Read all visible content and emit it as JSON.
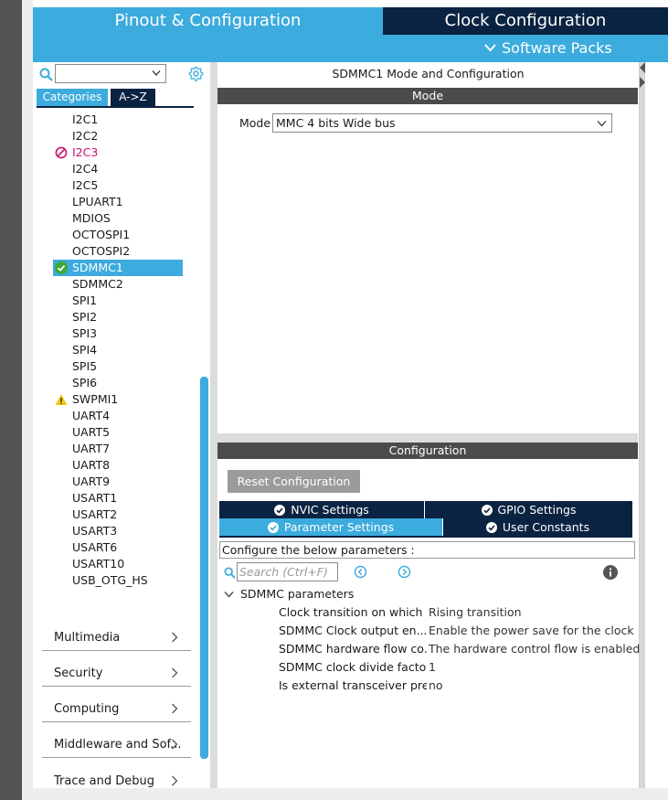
{
  "header": {
    "tab_pinout": "Pinout & Configuration",
    "tab_clock": "Clock Configuration",
    "software_packs": "Software Packs"
  },
  "left": {
    "search_value": "",
    "tab_categories": "Categories",
    "tab_az": "A->Z",
    "peripherals": [
      {
        "label": "I2C1",
        "status": "none"
      },
      {
        "label": "I2C2",
        "status": "none"
      },
      {
        "label": "I2C3",
        "status": "disabled"
      },
      {
        "label": "I2C4",
        "status": "none"
      },
      {
        "label": "I2C5",
        "status": "none"
      },
      {
        "label": "LPUART1",
        "status": "none"
      },
      {
        "label": "MDIOS",
        "status": "none"
      },
      {
        "label": "OCTOSPI1",
        "status": "none"
      },
      {
        "label": "OCTOSPI2",
        "status": "none"
      },
      {
        "label": "SDMMC1",
        "status": "ok"
      },
      {
        "label": "SDMMC2",
        "status": "none"
      },
      {
        "label": "SPI1",
        "status": "none"
      },
      {
        "label": "SPI2",
        "status": "none"
      },
      {
        "label": "SPI3",
        "status": "none"
      },
      {
        "label": "SPI4",
        "status": "none"
      },
      {
        "label": "SPI5",
        "status": "none"
      },
      {
        "label": "SPI6",
        "status": "none"
      },
      {
        "label": "SWPMI1",
        "status": "warning"
      },
      {
        "label": "UART4",
        "status": "none"
      },
      {
        "label": "UART5",
        "status": "none"
      },
      {
        "label": "UART7",
        "status": "none"
      },
      {
        "label": "UART8",
        "status": "none"
      },
      {
        "label": "UART9",
        "status": "none"
      },
      {
        "label": "USART1",
        "status": "none"
      },
      {
        "label": "USART2",
        "status": "none"
      },
      {
        "label": "USART3",
        "status": "none"
      },
      {
        "label": "USART6",
        "status": "none"
      },
      {
        "label": "USART10",
        "status": "none"
      },
      {
        "label": "USB_OTG_HS",
        "status": "none"
      }
    ],
    "categories": [
      "Multimedia",
      "Security",
      "Computing",
      "Middleware and Sof...",
      "Trace and Debug"
    ]
  },
  "right": {
    "mode_title": "SDMMC1 Mode and Configuration",
    "mode_bar": "Mode",
    "mode_label": "Mode",
    "mode_value": "MMC 4 bits Wide bus",
    "config_bar": "Configuration",
    "reset_button": "Reset Configuration",
    "tabs": {
      "nvic": "NVIC Settings",
      "gpio": "GPIO Settings",
      "param": "Parameter Settings",
      "user": "User Constants"
    },
    "configure_text": "Configure the below parameters :",
    "search_placeholder": "Search (Ctrl+F)",
    "group_title": "SDMMC parameters",
    "params": [
      {
        "name": "Clock transition on which ...",
        "value": "Rising transition"
      },
      {
        "name": "SDMMC Clock output en...",
        "value": "Enable the power save for the clock"
      },
      {
        "name": "SDMMC hardware flow co...",
        "value": "The hardware control flow is enabled"
      },
      {
        "name": "SDMMC clock divide factor",
        "value": "1"
      },
      {
        "name": "Is external transceiver pre...",
        "value": "no"
      }
    ]
  },
  "colors": {
    "accent": "#3cabdd",
    "navy": "#0b2342",
    "bar_gray": "#4b4b4b",
    "disabled_pink": "#c8136b",
    "ok_green": "#3aaa35",
    "warn_yellow": "#f2c811"
  }
}
